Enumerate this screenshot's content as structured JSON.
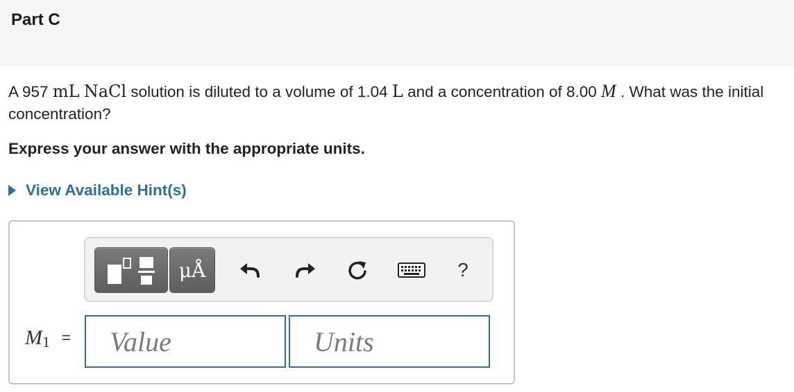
{
  "part": {
    "title": "Part C"
  },
  "question": {
    "text_1": "A 957 ",
    "unit_ml": "mL",
    "compound": "NaCl",
    "text_2": " solution is diluted to a volume of 1.04 ",
    "unit_l": "L",
    "text_3": " and a concentration of 8.00 ",
    "unit_m": "M",
    "text_4": " . What was the initial concentration?"
  },
  "instruction": "Express your answer with the appropriate units.",
  "hint": {
    "label": "View Available Hint(s)"
  },
  "toolbar": {
    "units_button_label": "μÅ",
    "help_label": "?",
    "icons": [
      "templates-icon",
      "units-icon",
      "undo-icon",
      "redo-icon",
      "reset-icon",
      "keyboard-icon",
      "help-icon"
    ]
  },
  "answer": {
    "variable": "M",
    "variable_subscript": "1",
    "equals": "=",
    "value_placeholder": "Value",
    "units_placeholder": "Units"
  },
  "colors": {
    "accent": "#2f6f95",
    "header_bg": "#f6f6f6",
    "toolbar_bg": "#f2f2f2",
    "button_dark": "#6a6a6a"
  }
}
